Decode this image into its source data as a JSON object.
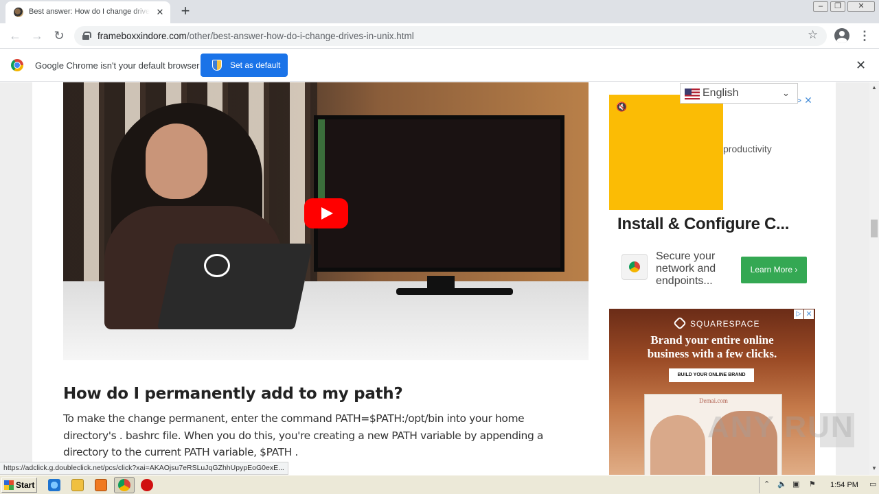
{
  "browser": {
    "tab_title": "Best answer: How do I change drive",
    "tab_close": "✕",
    "new_tab": "+",
    "url_domain": "frameboxxindore.com",
    "url_path": "/other/best-answer-how-do-i-change-drives-in-unix.html",
    "window_buttons": [
      "–",
      "❐",
      "✕"
    ]
  },
  "infobar": {
    "message": "Google Chrome isn't your default browser",
    "button": "Set as default",
    "close": "✕"
  },
  "article": {
    "heading": "How do I permanently add to my path?",
    "paragraph": "To make the change permanent, enter the command PATH=$PATH:/opt/bin into your home directory's . bashrc file. When you do this, you're creating a new PATH variable by appending a directory to the current PATH variable, $PATH ."
  },
  "language_selector": {
    "value": "English"
  },
  "ad1": {
    "snippet": "productivity",
    "headline": "Install & Configure C...",
    "description": "Secure your network and endpoints...",
    "button": "Learn More ›"
  },
  "ad2": {
    "brand": "SQUARESPACE",
    "headline_line1": "Brand your entire online",
    "headline_line2": "business with a few clicks.",
    "cta": "BUILD YOUR ONLINE BRAND",
    "site": "Demai.com"
  },
  "watermark": "ANY RUN",
  "status_link": "https://adclick.g.doubleclick.net/pcs/click?xai=AKAOjsu7eRSLuJqGZhhUpypEoG0exE...",
  "taskbar": {
    "start": "Start",
    "clock": "1:54 PM"
  }
}
